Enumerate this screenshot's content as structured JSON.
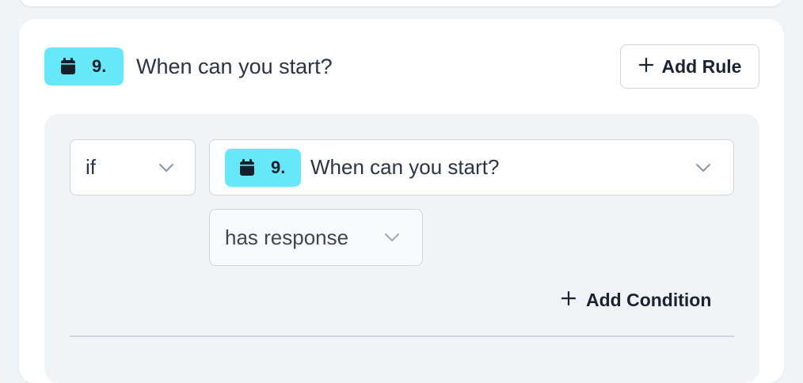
{
  "question": {
    "icon": "calendar-icon",
    "number": "9.",
    "title": "When can you start?"
  },
  "header": {
    "add_rule_label": "Add Rule",
    "add_rule_icon": "plus-icon"
  },
  "rule": {
    "if_select": {
      "value": "if",
      "icon": "chevron-down-icon"
    },
    "question_select": {
      "icon": "calendar-icon",
      "number": "9.",
      "value": "When can you start?",
      "chevron": "chevron-down-icon"
    },
    "operator_select": {
      "value": "has response",
      "icon": "chevron-down-icon"
    },
    "add_condition_label": "Add Condition",
    "add_condition_icon": "plus-icon"
  },
  "colors": {
    "badge": "#67e8f9",
    "card": "#ffffff",
    "panel": "#f1f4f7",
    "border": "#cfd5dc",
    "text": "#2b3345"
  }
}
